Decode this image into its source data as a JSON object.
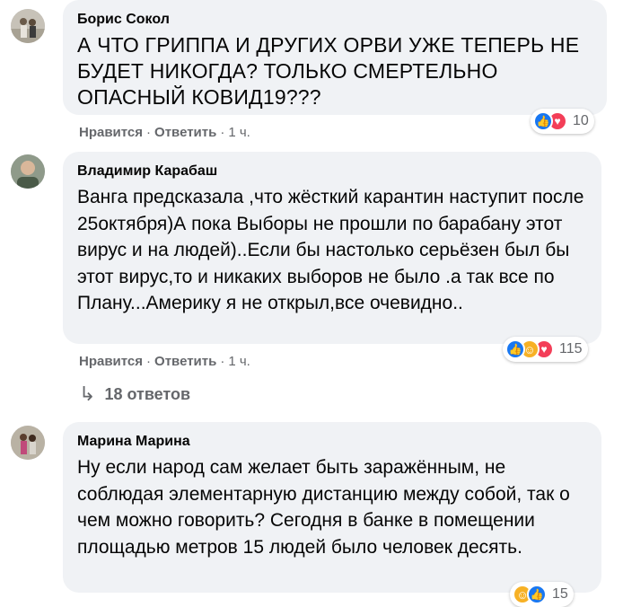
{
  "comments": [
    {
      "author": "Борис Сокол",
      "text": "А ЧТО ГРИППА И ДРУГИХ ОРВИ УЖЕ ТЕПЕРЬ НЕ БУДЕТ НИКОГДА? ТОЛЬКО СМЕРТЕЛЬНО ОПАСНЫЙ КОВИД19???",
      "like_label": "Нравится",
      "reply_label": "Ответить",
      "time": "1 ч.",
      "reactions": [
        "like",
        "love"
      ],
      "reaction_count": "10"
    },
    {
      "author": "Владимир Карабаш",
      "text": "Ванга предсказала ,что жёсткий карантин наступит после 25октября)А пока Выборы не прошли по барабану этот вирус и на людей)..Если бы настолько серьёзен был бы этот вирус,то и никаких выборов не было .а так все по Плану...Америку я не открыл,все очевидно..",
      "like_label": "Нравится",
      "reply_label": "Ответить",
      "time": "1 ч.",
      "reactions": [
        "like",
        "haha",
        "love"
      ],
      "reaction_count": "115",
      "replies_label": "18 ответов"
    },
    {
      "author": "Марина Марина",
      "text": "Ну если народ сам желает быть заражённым, не соблюдая элементарную дистанцию между собой, так о чем можно говорить? Сегодня в банке в помещении площадью метров 15 людей было человек десять.",
      "reactions": [
        "haha",
        "like"
      ],
      "reaction_count": "15"
    }
  ],
  "colors": {
    "bubble": "#f0f2f5",
    "meta": "#65676b",
    "like": "#1877f2",
    "love": "#f33e58",
    "haha": "#f7b125"
  }
}
